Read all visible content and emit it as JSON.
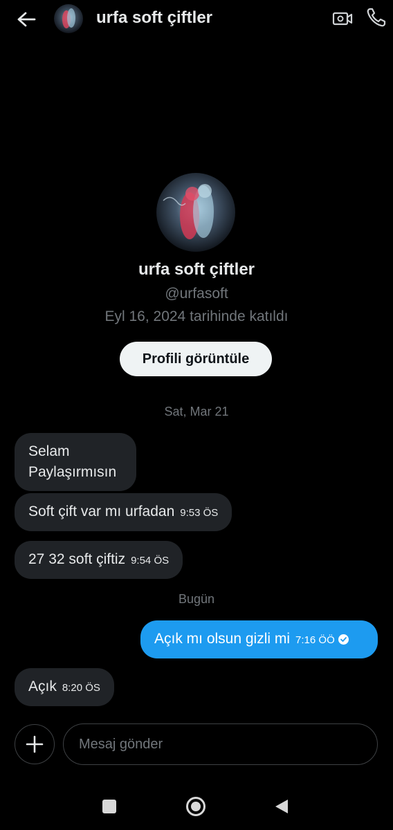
{
  "header": {
    "title": "urfa soft çiftler",
    "back_icon": "arrow-left-icon",
    "video_icon": "video-camera-icon",
    "call_icon": "phone-icon"
  },
  "profile": {
    "name": "urfa soft çiftler",
    "handle": "@urfasoft",
    "joined": "Eyl 16, 2024 tarihinde katıldı",
    "view_button": "Profili görüntüle"
  },
  "messages": {
    "date1": "Sat, Mar 21",
    "m1_line1": "Selam",
    "m1_line2": "Paylaşırmısın",
    "m2_text": "Soft çift var mı urfadan",
    "m2_time": "9:53 ÖS",
    "m3_text": "27 32 soft çiftiz",
    "m3_time": "9:54 ÖS",
    "date2": "Bugün",
    "m4_text": "Açık mı olsun gizli mi",
    "m4_time": "7:16 ÖÖ",
    "m5_text": "Açık",
    "m5_time": "8:20 ÖS"
  },
  "composer": {
    "placeholder": "Mesaj gönder",
    "plus_icon": "plus-icon"
  },
  "colors": {
    "background": "#000000",
    "incoming_bubble": "#202327",
    "outgoing_bubble": "#1d9bf0",
    "secondary_text": "#71767b",
    "button_bg": "#eff3f4"
  }
}
